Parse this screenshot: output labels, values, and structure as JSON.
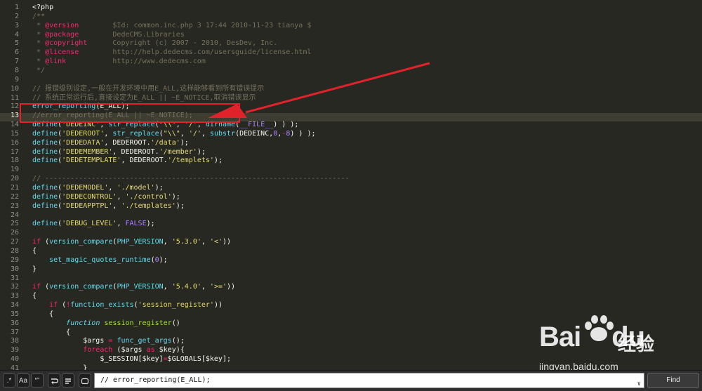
{
  "lines": [
    {
      "n": "1",
      "parts": [
        [
          "v",
          "<?php"
        ]
      ]
    },
    {
      "n": "2",
      "parts": [
        [
          "c",
          "/**"
        ]
      ]
    },
    {
      "n": "3",
      "parts": [
        [
          "c",
          " * "
        ],
        [
          "k",
          "@version"
        ],
        [
          "c",
          "        $Id: common.inc.php 3 17:44 2010-11-23 tianya $"
        ]
      ]
    },
    {
      "n": "4",
      "parts": [
        [
          "c",
          " * "
        ],
        [
          "k",
          "@package"
        ],
        [
          "c",
          "        DedeCMS.Libraries"
        ]
      ]
    },
    {
      "n": "5",
      "parts": [
        [
          "c",
          " * "
        ],
        [
          "k",
          "@copyright"
        ],
        [
          "c",
          "      Copyright (c) 2007 - 2010, DesDev, Inc."
        ]
      ]
    },
    {
      "n": "6",
      "parts": [
        [
          "c",
          " * "
        ],
        [
          "k",
          "@license"
        ],
        [
          "c",
          "        http://help.dedecms.com/usersguide/license.html"
        ]
      ]
    },
    {
      "n": "7",
      "parts": [
        [
          "c",
          " * "
        ],
        [
          "k",
          "@link"
        ],
        [
          "c",
          "           http://www.dedecms.com"
        ]
      ]
    },
    {
      "n": "8",
      "parts": [
        [
          "c",
          " */"
        ]
      ]
    },
    {
      "n": "9",
      "parts": []
    },
    {
      "n": "10",
      "parts": [
        [
          "c",
          "// 报错级别设定,一般在开发环境中用E_ALL,这样能够看到所有错误提示"
        ]
      ]
    },
    {
      "n": "11",
      "parts": [
        [
          "c",
          "// 系统正常运行后,直接设定为E_ALL || ~E_NOTICE,取消错误显示"
        ]
      ]
    },
    {
      "n": "12",
      "parts": [
        [
          "f",
          "error_reporting"
        ],
        [
          "v",
          "(E_ALL);"
        ]
      ]
    },
    {
      "n": "13",
      "active": true,
      "parts": [
        [
          "c",
          "//error_reporting(E_ALL || ~E_NOTICE);"
        ]
      ]
    },
    {
      "n": "14",
      "parts": [
        [
          "f",
          "define"
        ],
        [
          "v",
          "("
        ],
        [
          "s",
          "'DEDEINC'"
        ],
        [
          "v",
          ", "
        ],
        [
          "f",
          "str_replace"
        ],
        [
          "v",
          "("
        ],
        [
          "s",
          "\"\\\\\""
        ],
        [
          "v",
          ", "
        ],
        [
          "s",
          "'/'"
        ],
        [
          "v",
          ", "
        ],
        [
          "f",
          "dirname"
        ],
        [
          "v",
          "("
        ],
        [
          "n",
          "__FILE__"
        ],
        [
          "v",
          ") ) );"
        ]
      ]
    },
    {
      "n": "15",
      "parts": [
        [
          "f",
          "define"
        ],
        [
          "v",
          "("
        ],
        [
          "s",
          "'DEDEROOT'"
        ],
        [
          "v",
          ", "
        ],
        [
          "f",
          "str_replace"
        ],
        [
          "v",
          "("
        ],
        [
          "s",
          "\"\\\\\""
        ],
        [
          "v",
          ", "
        ],
        [
          "s",
          "'/'"
        ],
        [
          "v",
          ", "
        ],
        [
          "f",
          "substr"
        ],
        [
          "v",
          "(DEDEINC,"
        ],
        [
          "n",
          "0"
        ],
        [
          "v",
          ","
        ],
        [
          "o",
          "-"
        ],
        [
          "n",
          "8"
        ],
        [
          "v",
          ") ) );"
        ]
      ]
    },
    {
      "n": "16",
      "parts": [
        [
          "f",
          "define"
        ],
        [
          "v",
          "("
        ],
        [
          "s",
          "'DEDEDATA'"
        ],
        [
          "v",
          ", DEDEROOT."
        ],
        [
          "s",
          "'/data'"
        ],
        [
          "v",
          ");"
        ]
      ]
    },
    {
      "n": "17",
      "parts": [
        [
          "f",
          "define"
        ],
        [
          "v",
          "("
        ],
        [
          "s",
          "'DEDEMEMBER'"
        ],
        [
          "v",
          ", DEDEROOT."
        ],
        [
          "s",
          "'/member'"
        ],
        [
          "v",
          ");"
        ]
      ]
    },
    {
      "n": "18",
      "parts": [
        [
          "f",
          "define"
        ],
        [
          "v",
          "("
        ],
        [
          "s",
          "'DEDETEMPLATE'"
        ],
        [
          "v",
          ", DEDEROOT."
        ],
        [
          "s",
          "'/templets'"
        ],
        [
          "v",
          ");"
        ]
      ]
    },
    {
      "n": "19",
      "parts": []
    },
    {
      "n": "20",
      "parts": [
        [
          "c",
          "// ------------------------------------------------------------------------"
        ]
      ]
    },
    {
      "n": "21",
      "parts": [
        [
          "f",
          "define"
        ],
        [
          "v",
          "("
        ],
        [
          "s",
          "'DEDEMODEL'"
        ],
        [
          "v",
          ", "
        ],
        [
          "s",
          "'./model'"
        ],
        [
          "v",
          ");"
        ]
      ]
    },
    {
      "n": "22",
      "parts": [
        [
          "f",
          "define"
        ],
        [
          "v",
          "("
        ],
        [
          "s",
          "'DEDECONTROL'"
        ],
        [
          "v",
          ", "
        ],
        [
          "s",
          "'./control'"
        ],
        [
          "v",
          ");"
        ]
      ]
    },
    {
      "n": "23",
      "parts": [
        [
          "f",
          "define"
        ],
        [
          "v",
          "("
        ],
        [
          "s",
          "'DEDEAPPTPL'"
        ],
        [
          "v",
          ", "
        ],
        [
          "s",
          "'./templates'"
        ],
        [
          "v",
          ");"
        ]
      ]
    },
    {
      "n": "24",
      "parts": []
    },
    {
      "n": "25",
      "parts": [
        [
          "f",
          "define"
        ],
        [
          "v",
          "("
        ],
        [
          "s",
          "'DEBUG_LEVEL'"
        ],
        [
          "v",
          ", "
        ],
        [
          "n",
          "FALSE"
        ],
        [
          "v",
          ");"
        ]
      ]
    },
    {
      "n": "26",
      "parts": []
    },
    {
      "n": "27",
      "parts": [
        [
          "k",
          "if"
        ],
        [
          "v",
          " ("
        ],
        [
          "f",
          "version_compare"
        ],
        [
          "v",
          "("
        ],
        [
          "f",
          "PHP_VERSION"
        ],
        [
          "v",
          ", "
        ],
        [
          "s",
          "'5.3.0'"
        ],
        [
          "v",
          ", "
        ],
        [
          "s",
          "'<'"
        ],
        [
          "v",
          "))"
        ]
      ]
    },
    {
      "n": "28",
      "parts": [
        [
          "v",
          "{"
        ]
      ]
    },
    {
      "n": "29",
      "parts": [
        [
          "v",
          "    "
        ],
        [
          "f",
          "set_magic_quotes_runtime"
        ],
        [
          "v",
          "("
        ],
        [
          "n",
          "0"
        ],
        [
          "v",
          ");"
        ]
      ]
    },
    {
      "n": "30",
      "parts": [
        [
          "v",
          "}"
        ]
      ]
    },
    {
      "n": "31",
      "parts": []
    },
    {
      "n": "32",
      "parts": [
        [
          "k",
          "if"
        ],
        [
          "v",
          " ("
        ],
        [
          "f",
          "version_compare"
        ],
        [
          "v",
          "("
        ],
        [
          "f",
          "PHP_VERSION"
        ],
        [
          "v",
          ", "
        ],
        [
          "s",
          "'5.4.0'"
        ],
        [
          "v",
          ", "
        ],
        [
          "s",
          "'>='"
        ],
        [
          "v",
          "))"
        ]
      ]
    },
    {
      "n": "33",
      "parts": [
        [
          "v",
          "{"
        ]
      ]
    },
    {
      "n": "34",
      "parts": [
        [
          "v",
          "    "
        ],
        [
          "k",
          "if"
        ],
        [
          "v",
          " ("
        ],
        [
          "o",
          "!"
        ],
        [
          "f",
          "function_exists"
        ],
        [
          "v",
          "("
        ],
        [
          "s",
          "'session_register'"
        ],
        [
          "v",
          "))"
        ]
      ]
    },
    {
      "n": "35",
      "parts": [
        [
          "v",
          "    {"
        ]
      ]
    },
    {
      "n": "36",
      "parts": [
        [
          "v",
          "        "
        ],
        [
          "i",
          "function"
        ],
        [
          "v",
          " "
        ],
        [
          "g",
          "session_register"
        ],
        [
          "v",
          "()"
        ]
      ]
    },
    {
      "n": "37",
      "parts": [
        [
          "v",
          "        {"
        ]
      ]
    },
    {
      "n": "38",
      "parts": [
        [
          "v",
          "            $args "
        ],
        [
          "o",
          "="
        ],
        [
          "v",
          " "
        ],
        [
          "f",
          "func_get_args"
        ],
        [
          "v",
          "();"
        ]
      ]
    },
    {
      "n": "39",
      "parts": [
        [
          "v",
          "            "
        ],
        [
          "k",
          "foreach"
        ],
        [
          "v",
          " ($args "
        ],
        [
          "k",
          "as"
        ],
        [
          "v",
          " $key){"
        ]
      ]
    },
    {
      "n": "40",
      "parts": [
        [
          "v",
          "                $_SESSION[$key]"
        ],
        [
          "o",
          "="
        ],
        [
          "v",
          "$GLOBALS[$key];"
        ]
      ]
    },
    {
      "n": "41",
      "parts": [
        [
          "v",
          "            }"
        ]
      ]
    }
  ],
  "findbar": {
    "regex_label": ".*",
    "case_label": "Aa",
    "word_label": "“”",
    "input_value": "// error_reporting(E_ALL);",
    "find_label": "Find",
    "dropdown_glyph": "∨"
  },
  "watermark": {
    "logo": "Bai",
    "logo_tail": "du",
    "cn": "经验",
    "url": "jingyan.baidu.com"
  },
  "colors": {
    "annotation": "#e0232a",
    "background": "#272822"
  }
}
